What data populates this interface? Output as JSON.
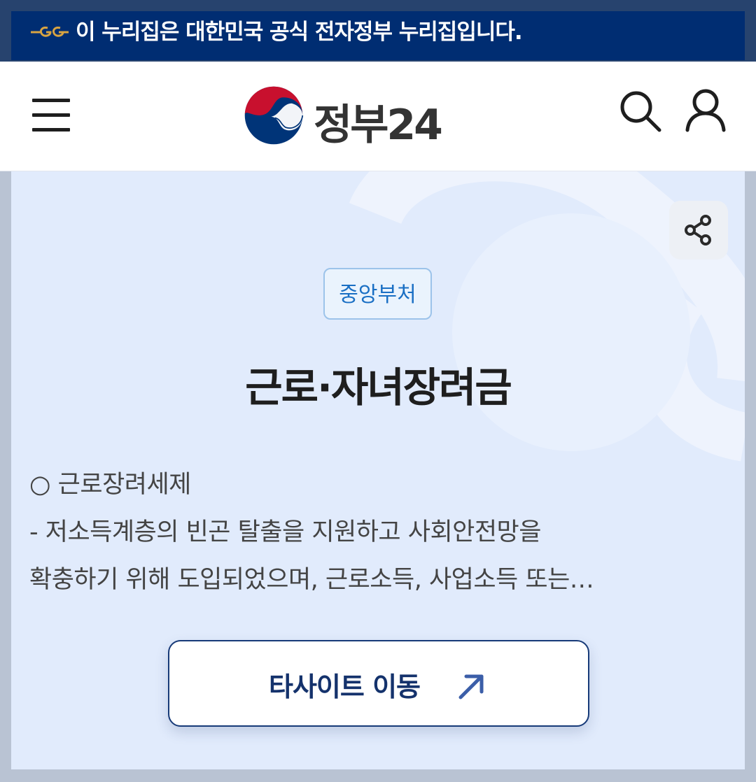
{
  "gov_banner": {
    "text": "이 누리집은 대한민국 공식 전자정부 누리집입니다."
  },
  "header": {
    "logo_text": "정부24"
  },
  "service": {
    "category_badge": "중앙부처",
    "title": "근로·자녀장려금",
    "description_lines": [
      "○ 근로장려세제",
      "- 저소득계층의 빈곤 탈출을 지원하고 사회안전망을",
      "확충하기 위해 도입되었으며, 근로소득, 사업소득 또는…"
    ],
    "external_link_label": "타사이트 이동"
  },
  "colors": {
    "banner_bg": "#002d72",
    "page_bg": "#e1ebfc",
    "badge_text": "#1a6fc4",
    "button_border": "#173a78",
    "emblem_red": "#c8102e",
    "emblem_blue": "#003478"
  },
  "icons": [
    "gov-mark-icon",
    "menu-icon",
    "emblem-icon",
    "search-icon",
    "user-icon",
    "share-icon",
    "external-arrow-icon"
  ]
}
